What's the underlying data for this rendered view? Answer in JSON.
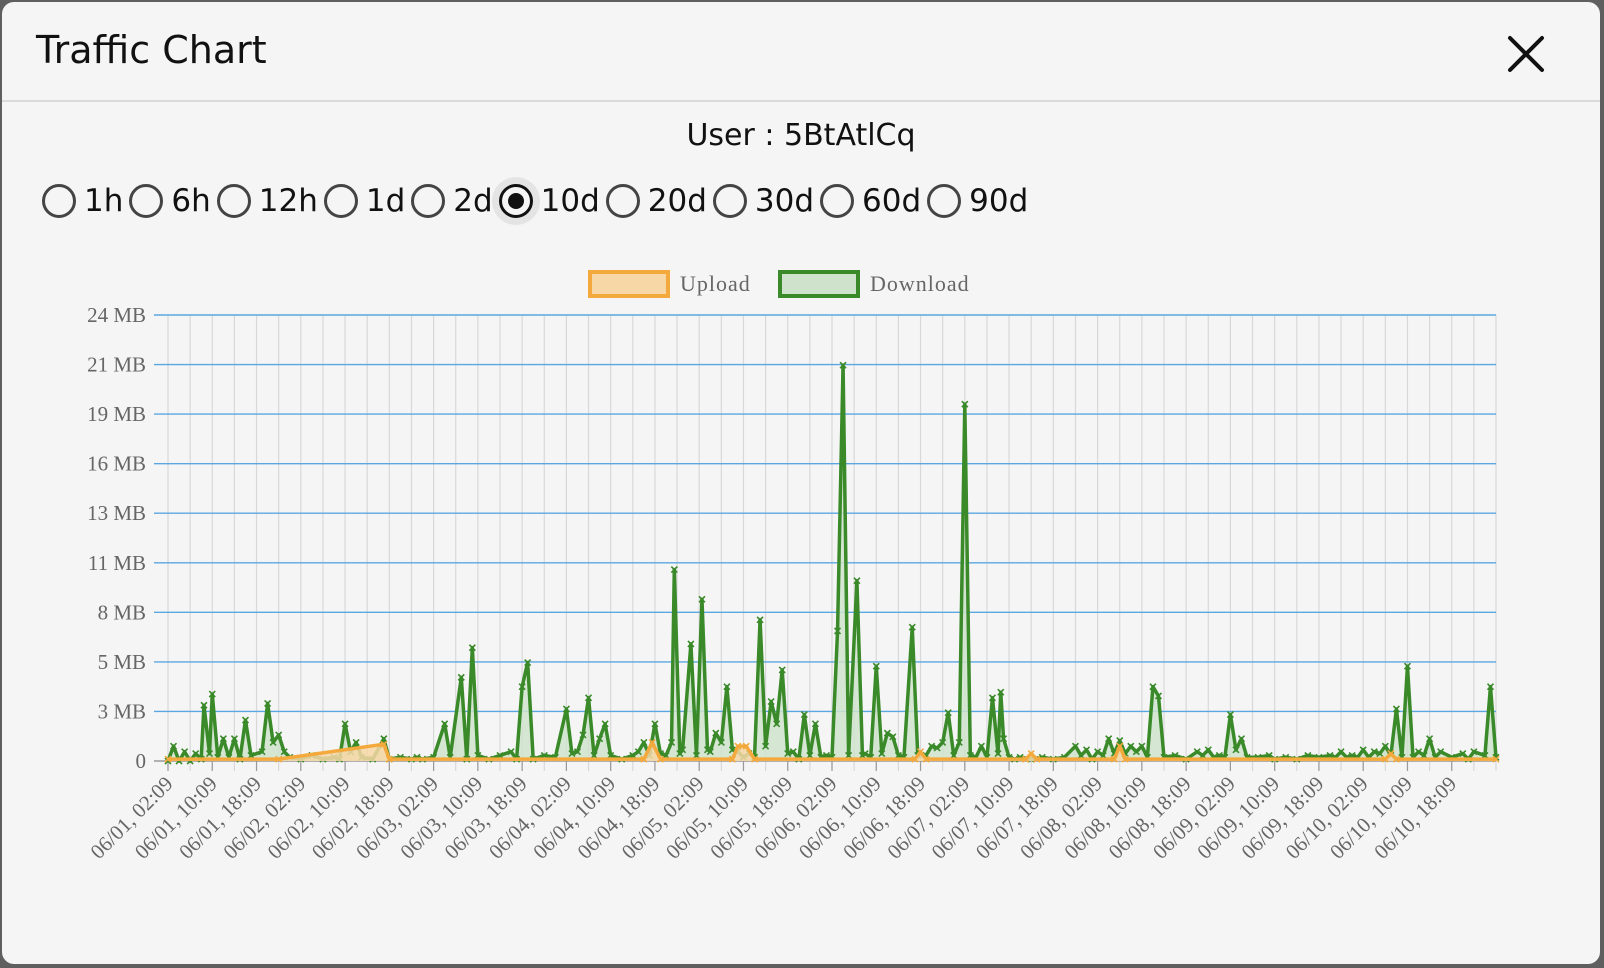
{
  "dialog": {
    "title": "Traffic Chart",
    "close_icon": "close-icon"
  },
  "user_label": "User : 5BtAtlCq",
  "ranges": [
    {
      "label": "1h",
      "selected": false
    },
    {
      "label": "6h",
      "selected": false
    },
    {
      "label": "12h",
      "selected": false
    },
    {
      "label": "1d",
      "selected": false
    },
    {
      "label": "2d",
      "selected": false
    },
    {
      "label": "10d",
      "selected": true
    },
    {
      "label": "20d",
      "selected": false
    },
    {
      "label": "30d",
      "selected": false
    },
    {
      "label": "60d",
      "selected": false
    },
    {
      "label": "90d",
      "selected": false
    }
  ],
  "chart_data": {
    "type": "area",
    "legend_position": "top-center",
    "grid": true,
    "y_ticks": [
      "0",
      "3 MB",
      "5 MB",
      "8 MB",
      "11 MB",
      "13 MB",
      "16 MB",
      "19 MB",
      "21 MB",
      "24 MB"
    ],
    "ylim_mb": [
      0,
      24
    ],
    "x_tick_labels": [
      "06/01, 02:09",
      "06/01, 10:09",
      "06/01, 18:09",
      "06/02, 02:09",
      "06/02, 10:09",
      "06/02, 18:09",
      "06/03, 02:09",
      "06/03, 10:09",
      "06/03, 18:09",
      "06/04, 02:09",
      "06/04, 10:09",
      "06/04, 18:09",
      "06/05, 02:09",
      "06/05, 10:09",
      "06/05, 18:09",
      "06/06, 02:09",
      "06/06, 10:09",
      "06/06, 18:09",
      "06/07, 02:09",
      "06/07, 10:09",
      "06/07, 18:09",
      "06/08, 02:09",
      "06/08, 10:09",
      "06/08, 18:09",
      "06/09, 02:09",
      "06/09, 10:09",
      "06/09, 18:09",
      "06/10, 02:09",
      "06/10, 10:09",
      "06/10, 18:09"
    ],
    "x_hours_span": [
      0,
      240
    ],
    "series": [
      {
        "name": "Upload",
        "border_color": "#f4a93c",
        "fill_color": "#f7d7a6",
        "points": [
          [
            0,
            0.1
          ],
          [
            20,
            0.1
          ],
          [
            39,
            0.9
          ],
          [
            40,
            0.1
          ],
          [
            86,
            0.1
          ],
          [
            87.5,
            1.0
          ],
          [
            89,
            0.1
          ],
          [
            102,
            0.1
          ],
          [
            103,
            0.8
          ],
          [
            104.5,
            0.8
          ],
          [
            106,
            0.1
          ],
          [
            135,
            0.1
          ],
          [
            136,
            0.5
          ],
          [
            137,
            0.1
          ],
          [
            155,
            0.1
          ],
          [
            156,
            0.4
          ],
          [
            157,
            0.1
          ],
          [
            171,
            0.1
          ],
          [
            172,
            0.8
          ],
          [
            173,
            0.1
          ],
          [
            220,
            0.1
          ],
          [
            221,
            0.4
          ],
          [
            222,
            0.1
          ],
          [
            240,
            0.1
          ]
        ]
      },
      {
        "name": "Download",
        "border_color": "#3a8a2a",
        "fill_color": "#cfe3cc",
        "points": [
          [
            0,
            0
          ],
          [
            1,
            0.8
          ],
          [
            2,
            0
          ],
          [
            3,
            0.5
          ],
          [
            4,
            0
          ],
          [
            5,
            0.4
          ],
          [
            6,
            0.1
          ],
          [
            6.5,
            3.0
          ],
          [
            7.5,
            0.4
          ],
          [
            8,
            3.6
          ],
          [
            9,
            0.2
          ],
          [
            10,
            1.2
          ],
          [
            11,
            0.2
          ],
          [
            12,
            1.2
          ],
          [
            13,
            0.1
          ],
          [
            14,
            2.2
          ],
          [
            15,
            0.3
          ],
          [
            17,
            0.5
          ],
          [
            18,
            3.1
          ],
          [
            19,
            1.0
          ],
          [
            20,
            1.4
          ],
          [
            21,
            0.5
          ],
          [
            22,
            0.2
          ],
          [
            24,
            0.1
          ],
          [
            26,
            0.3
          ],
          [
            28,
            0.1
          ],
          [
            30,
            0.2
          ],
          [
            31,
            0.1
          ],
          [
            32,
            2.0
          ],
          [
            33,
            0.5
          ],
          [
            34,
            1.0
          ],
          [
            35,
            0.2
          ],
          [
            37,
            0.1
          ],
          [
            39,
            1.2
          ],
          [
            40,
            0.1
          ],
          [
            42,
            0.2
          ],
          [
            44,
            0.1
          ],
          [
            45,
            0.2
          ],
          [
            46,
            0.1
          ],
          [
            48,
            0.2
          ],
          [
            50,
            2.0
          ],
          [
            51,
            0.2
          ],
          [
            53,
            4.5
          ],
          [
            54,
            0.1
          ],
          [
            55,
            6.1
          ],
          [
            56,
            0.3
          ],
          [
            58,
            0.1
          ],
          [
            60,
            0.3
          ],
          [
            62,
            0.5
          ],
          [
            63,
            0.1
          ],
          [
            64,
            4.0
          ],
          [
            65,
            5.3
          ],
          [
            66,
            0.1
          ],
          [
            68,
            0.3
          ],
          [
            70,
            0.2
          ],
          [
            72,
            2.8
          ],
          [
            73,
            0.4
          ],
          [
            74,
            0.5
          ],
          [
            75,
            1.4
          ],
          [
            76,
            3.4
          ],
          [
            77,
            0.3
          ],
          [
            78,
            1.2
          ],
          [
            79,
            2.0
          ],
          [
            80,
            0.3
          ],
          [
            82,
            0.1
          ],
          [
            84,
            0.3
          ],
          [
            85,
            0.5
          ],
          [
            86,
            1.0
          ],
          [
            87,
            0.3
          ],
          [
            88,
            2.0
          ],
          [
            89,
            0.4
          ],
          [
            90,
            0.3
          ],
          [
            91,
            1.0
          ],
          [
            91.5,
            10.3
          ],
          [
            92.5,
            0.4
          ],
          [
            93,
            0.6
          ],
          [
            94.5,
            6.3
          ],
          [
            95.5,
            0.3
          ],
          [
            96.5,
            8.7
          ],
          [
            97.5,
            0.6
          ],
          [
            98,
            0.5
          ],
          [
            99,
            1.5
          ],
          [
            100,
            1.0
          ],
          [
            101,
            4.0
          ],
          [
            102,
            0.6
          ],
          [
            103,
            0.5
          ],
          [
            104,
            0.2
          ],
          [
            105,
            0.4
          ],
          [
            106,
            0.2
          ],
          [
            107,
            7.6
          ],
          [
            108,
            0.8
          ],
          [
            109,
            3.2
          ],
          [
            110,
            2.0
          ],
          [
            111,
            4.9
          ],
          [
            112,
            0.4
          ],
          [
            113,
            0.5
          ],
          [
            114,
            0.1
          ],
          [
            115,
            2.5
          ],
          [
            116,
            0.3
          ],
          [
            117,
            2.0
          ],
          [
            118,
            0.2
          ],
          [
            119,
            0.3
          ],
          [
            120,
            0.2
          ],
          [
            121,
            7.0
          ],
          [
            122,
            21.3
          ],
          [
            123,
            0.3
          ],
          [
            124.5,
            9.7
          ],
          [
            125.5,
            0.3
          ],
          [
            126,
            0.4
          ],
          [
            127,
            0.2
          ],
          [
            128,
            5.1
          ],
          [
            129,
            0.4
          ],
          [
            130,
            1.5
          ],
          [
            131,
            1.3
          ],
          [
            132,
            0.3
          ],
          [
            133,
            0.2
          ],
          [
            134.5,
            7.2
          ],
          [
            135.5,
            0.3
          ],
          [
            137,
            0.3
          ],
          [
            138,
            0.8
          ],
          [
            139,
            0.7
          ],
          [
            140,
            1.0
          ],
          [
            141,
            2.6
          ],
          [
            142,
            0.3
          ],
          [
            143,
            1.0
          ],
          [
            144,
            19.2
          ],
          [
            145,
            0.3
          ],
          [
            146,
            0.2
          ],
          [
            147,
            0.8
          ],
          [
            148,
            0.2
          ],
          [
            149,
            3.4
          ],
          [
            150,
            0.4
          ],
          [
            150.5,
            3.7
          ],
          [
            151,
            1.2
          ],
          [
            152,
            0.2
          ],
          [
            153,
            0.1
          ],
          [
            154,
            0.2
          ],
          [
            156,
            0.1
          ],
          [
            158,
            0.2
          ],
          [
            160,
            0.1
          ],
          [
            162,
            0.2
          ],
          [
            164,
            0.8
          ],
          [
            165,
            0.3
          ],
          [
            166,
            0.6
          ],
          [
            167,
            0.1
          ],
          [
            168,
            0.5
          ],
          [
            169,
            0.3
          ],
          [
            170,
            1.2
          ],
          [
            171,
            0.4
          ],
          [
            172,
            1.1
          ],
          [
            173,
            0.4
          ],
          [
            174,
            0.8
          ],
          [
            175,
            0.5
          ],
          [
            176,
            0.8
          ],
          [
            177,
            0.2
          ],
          [
            178,
            4.0
          ],
          [
            179,
            3.5
          ],
          [
            180,
            0.2
          ],
          [
            182,
            0.3
          ],
          [
            184,
            0.1
          ],
          [
            186,
            0.5
          ],
          [
            187,
            0.3
          ],
          [
            188,
            0.6
          ],
          [
            189,
            0.2
          ],
          [
            190,
            0.3
          ],
          [
            191,
            0.2
          ],
          [
            192,
            2.5
          ],
          [
            193,
            0.6
          ],
          [
            194,
            1.2
          ],
          [
            195,
            0.2
          ],
          [
            197,
            0.2
          ],
          [
            199,
            0.3
          ],
          [
            200,
            0.1
          ],
          [
            202,
            0.2
          ],
          [
            204,
            0.1
          ],
          [
            206,
            0.3
          ],
          [
            208,
            0.2
          ],
          [
            210,
            0.3
          ],
          [
            211,
            0.2
          ],
          [
            212,
            0.5
          ],
          [
            213,
            0.2
          ],
          [
            214,
            0.3
          ],
          [
            215,
            0.2
          ],
          [
            216,
            0.6
          ],
          [
            217,
            0.2
          ],
          [
            218,
            0.5
          ],
          [
            219,
            0.4
          ],
          [
            220,
            0.8
          ],
          [
            221,
            0.3
          ],
          [
            222,
            2.8
          ],
          [
            223,
            0.2
          ],
          [
            224,
            5.1
          ],
          [
            225,
            0.2
          ],
          [
            226,
            0.5
          ],
          [
            227,
            0.3
          ],
          [
            228,
            1.2
          ],
          [
            229,
            0.2
          ],
          [
            230,
            0.5
          ],
          [
            232,
            0.2
          ],
          [
            234,
            0.4
          ],
          [
            235,
            0.1
          ],
          [
            236,
            0.5
          ],
          [
            238,
            0.3
          ],
          [
            239,
            4.0
          ],
          [
            240,
            0.2
          ]
        ]
      }
    ]
  }
}
